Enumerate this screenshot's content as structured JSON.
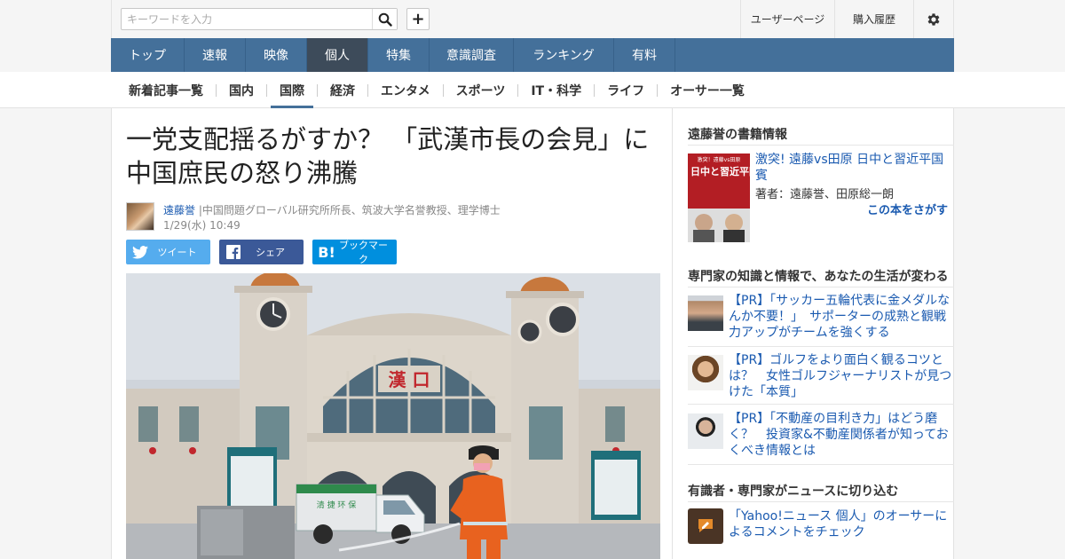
{
  "header": {
    "search_placeholder": "キーワードを入力",
    "user_page": "ユーザーページ",
    "purchase_history": "購入履歴"
  },
  "main_nav": [
    {
      "label": "トップ"
    },
    {
      "label": "速報"
    },
    {
      "label": "映像"
    },
    {
      "label": "個人",
      "active": true
    },
    {
      "label": "特集"
    },
    {
      "label": "意識調査"
    },
    {
      "label": "ランキング"
    },
    {
      "label": "有料"
    }
  ],
  "sub_nav": [
    {
      "label": "新着記事一覧"
    },
    {
      "label": "国内"
    },
    {
      "label": "国際",
      "active": true
    },
    {
      "label": "経済"
    },
    {
      "label": "エンタメ"
    },
    {
      "label": "スポーツ"
    },
    {
      "label": "IT・科学"
    },
    {
      "label": "ライフ"
    },
    {
      "label": "オーサー一覧"
    }
  ],
  "article": {
    "title": "一党支配揺るがすか？ 「武漢市長の会見」に中国庶民の怒り沸騰",
    "author_name": "遠藤誉",
    "author_desc": "|中国問題グローバル研究所所長、筑波大学名誉教授、理学博士",
    "date": "1/29(水) 10:49",
    "share_twitter": "ツイート",
    "share_facebook": "シェア",
    "share_hatena": "ブックマーク",
    "photo_sign": "漢 口",
    "truck_text": "清 捷 环 保"
  },
  "sidebar": {
    "book_section_title": "遠藤誉の書籍情報",
    "book": {
      "title": "激突! 遠藤vs田原 日中と習近平国賓",
      "author": "著者：遠藤誉、田原総一朗",
      "link": "この本をさがす",
      "cover_top": "激突！遠藤vs田原",
      "cover_main": "日中と習近平国賓"
    },
    "pr_section_title": "専門家の知識と情報で、あなたの生活が変わる",
    "pr_items": [
      {
        "text": "【PR】「サッカー五輪代表に金メダルなんか不要！」　サポーターの成熟と観戦力アップがチームを強くする"
      },
      {
        "text": "【PR】ゴルフをより面白く観るコツとは？　女性ゴルフジャーナリストが見つけた「本質」"
      },
      {
        "text": "【PR】「不動産の目利き力」はどう磨く？　投資家&不動産関係者が知っておくべき情報とは"
      }
    ],
    "expert_section_title": "有識者・専門家がニュースに切り込む",
    "expert_item": {
      "text": "「Yahoo!ニュース 個人」のオーサーによるコメントをチェック"
    }
  },
  "colors": {
    "nav_bg": "#44709a",
    "nav_active": "#3d4b5a",
    "link": "#1a5ab0",
    "twitter": "#55acee",
    "facebook": "#3b5998",
    "hatena": "#008fde"
  },
  "icons": [
    "search-icon",
    "plus-icon",
    "gear-icon",
    "twitter-icon",
    "facebook-icon",
    "hatena-icon"
  ]
}
